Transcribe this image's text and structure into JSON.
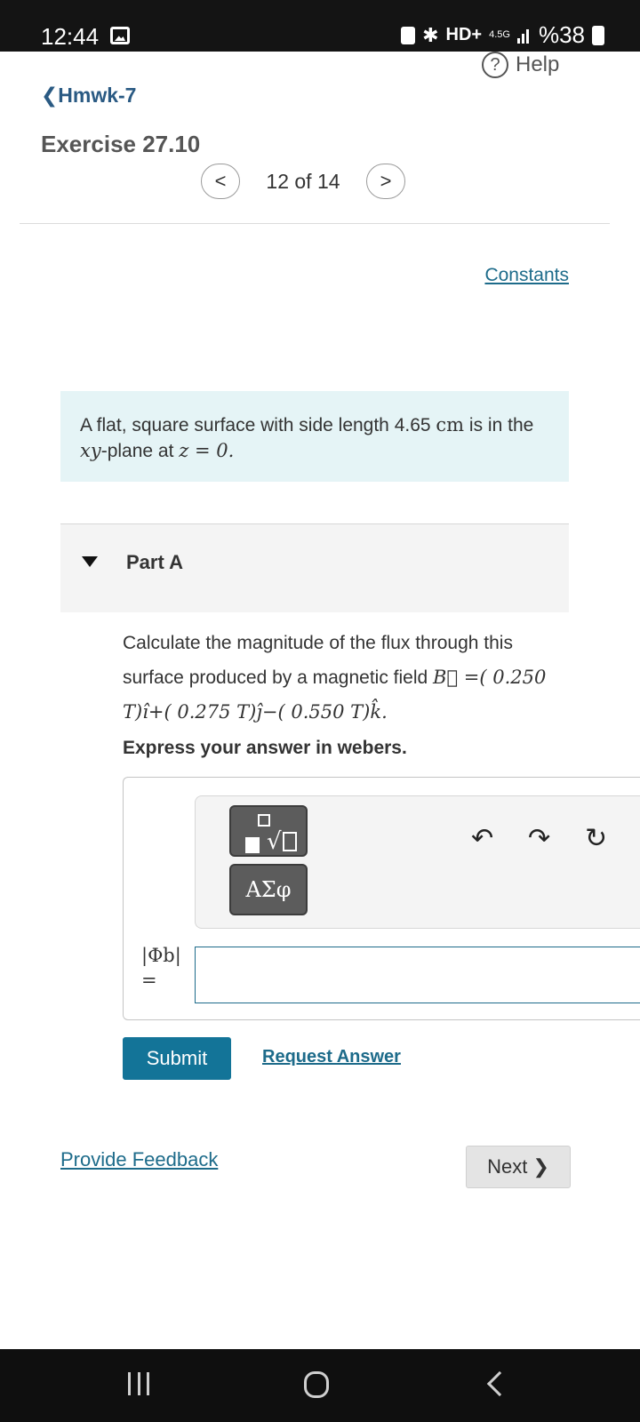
{
  "status_bar": {
    "time": "12:44",
    "hd_label": "HD+",
    "network_label": "4.5G",
    "battery_text": "%38",
    "icons": [
      "image-icon",
      "lock-icon",
      "bluetooth-icon",
      "signal-icon",
      "battery-icon"
    ]
  },
  "header": {
    "help_label": "Help",
    "back_label": "Hmwk-7",
    "title": "Exercise 27.10"
  },
  "pager": {
    "text": "12 of 14",
    "prev_label": "<",
    "next_label": ">"
  },
  "constants_label": "Constants",
  "problem": {
    "intro_part1": "A flat, square surface with side length 4.65 ",
    "intro_unit": "cm",
    "intro_part2": " is in the ",
    "intro_var": "xy",
    "intro_part3": "-plane at ",
    "intro_eq": "z = 0.",
    "part_label": "Part A",
    "question_text": "Calculate the magnitude of the flux through this surface produced by a magnetic field ",
    "field_expr": "B⃗ =( 0.250 T)î+( 0.275 T)ĵ−( 0.550 T)k̂.",
    "express_label": "Express your answer in webers."
  },
  "answer": {
    "variable_label": "|Φb|",
    "equals": "=",
    "input_value": "",
    "toolbar": {
      "template_button": "templates",
      "symbols_label": "ΑΣφ",
      "undo_icon": "↶",
      "redo_icon": "↷",
      "reset_icon": "↻"
    }
  },
  "actions": {
    "submit_label": "Submit",
    "request_answer_label": "Request Answer",
    "feedback_label": "Provide Feedback",
    "next_label": "Next ❯"
  },
  "colors": {
    "link": "#1d6b8a",
    "submit_bg": "#137498",
    "intro_bg": "#e5f4f6"
  }
}
